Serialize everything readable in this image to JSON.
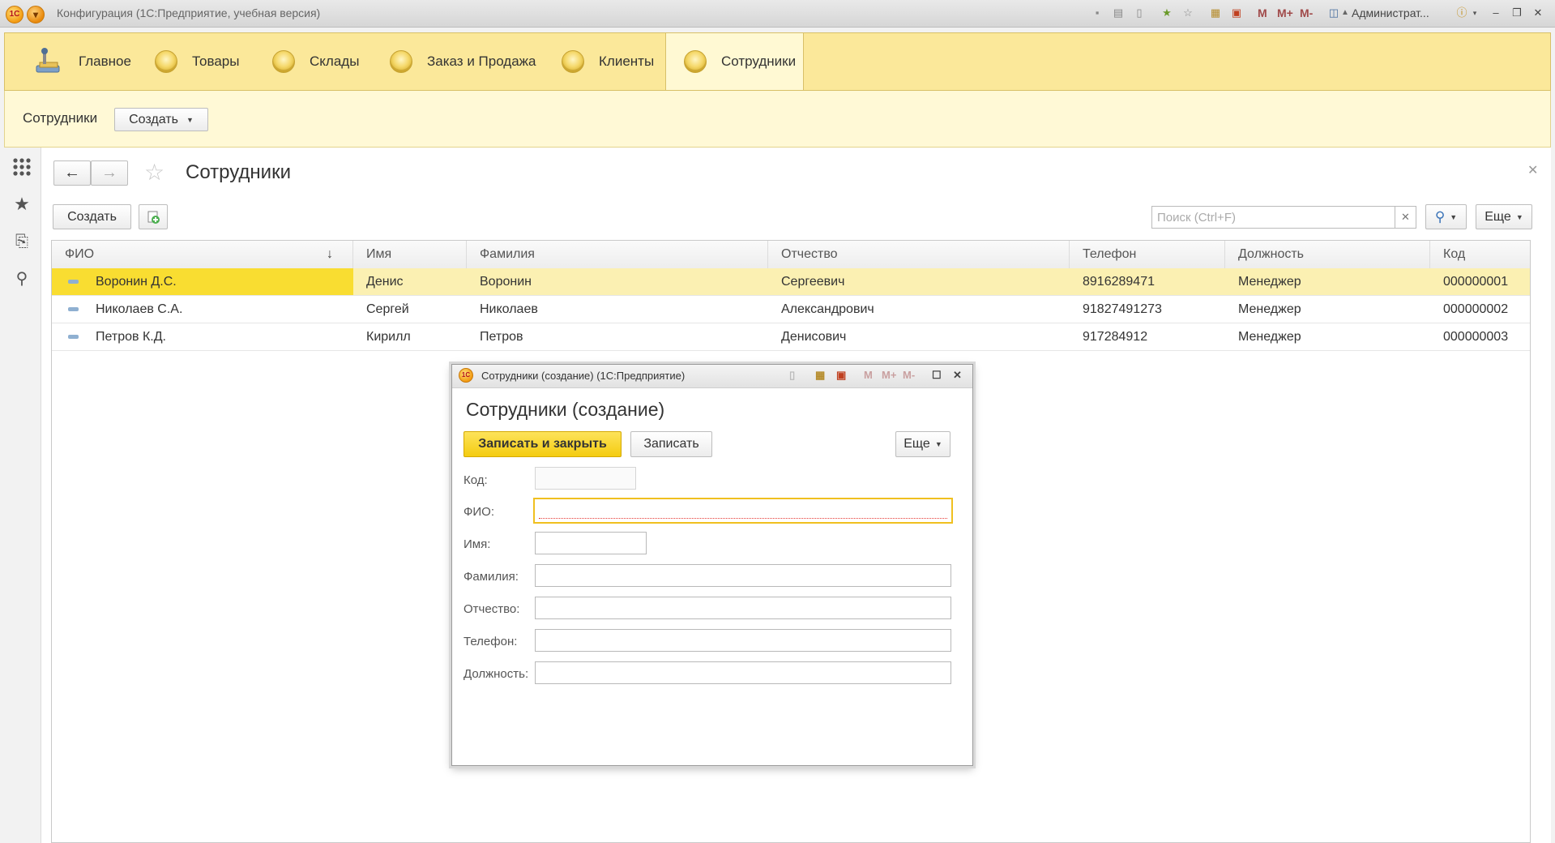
{
  "window": {
    "title": "Конфигурация (1С:Предприятие, учебная версия)",
    "logo_text": "1С",
    "user": "Администрат...",
    "m_labels": [
      "M",
      "M+",
      "M-"
    ]
  },
  "sections": [
    {
      "label": "Главное"
    },
    {
      "label": "Товары"
    },
    {
      "label": "Склады"
    },
    {
      "label": "Заказ и Продажа"
    },
    {
      "label": "Клиенты"
    },
    {
      "label": "Сотрудники"
    }
  ],
  "function_panel": {
    "title": "Сотрудники",
    "create_label": "Создать"
  },
  "form": {
    "title": "Сотрудники",
    "create_label": "Создать",
    "search_placeholder": "Поиск (Ctrl+F)",
    "more_label": "Еще"
  },
  "table": {
    "columns": [
      "ФИО",
      "Имя",
      "Фамилия",
      "Отчество",
      "Телефон",
      "Должность",
      "Код"
    ],
    "sort_arrow": "↓",
    "rows": [
      [
        "Воронин Д.С.",
        "Денис",
        "Воронин",
        "Сергеевич",
        "8916289471",
        "Менеджер",
        "000000001"
      ],
      [
        "Николаев С.А.",
        "Сергей",
        "Николаев",
        "Александрович",
        "91827491273",
        "Менеджер",
        "000000002"
      ],
      [
        "Петров К.Д.",
        "Кирилл",
        "Петров",
        "Денисович",
        "917284912",
        "Менеджер",
        "000000003"
      ]
    ]
  },
  "modal": {
    "window_title": "Сотрудники (создание)  (1С:Предприятие)",
    "heading": "Сотрудники (создание)",
    "save_close_label": "Записать и закрыть",
    "save_label": "Записать",
    "more_label": "Еще",
    "fields": [
      {
        "label": "Код:",
        "value": ""
      },
      {
        "label": "ФИО:",
        "value": ""
      },
      {
        "label": "Имя:",
        "value": ""
      },
      {
        "label": "Фамилия:",
        "value": ""
      },
      {
        "label": "Отчество:",
        "value": ""
      },
      {
        "label": "Телефон:",
        "value": ""
      },
      {
        "label": "Должность:",
        "value": ""
      }
    ]
  }
}
